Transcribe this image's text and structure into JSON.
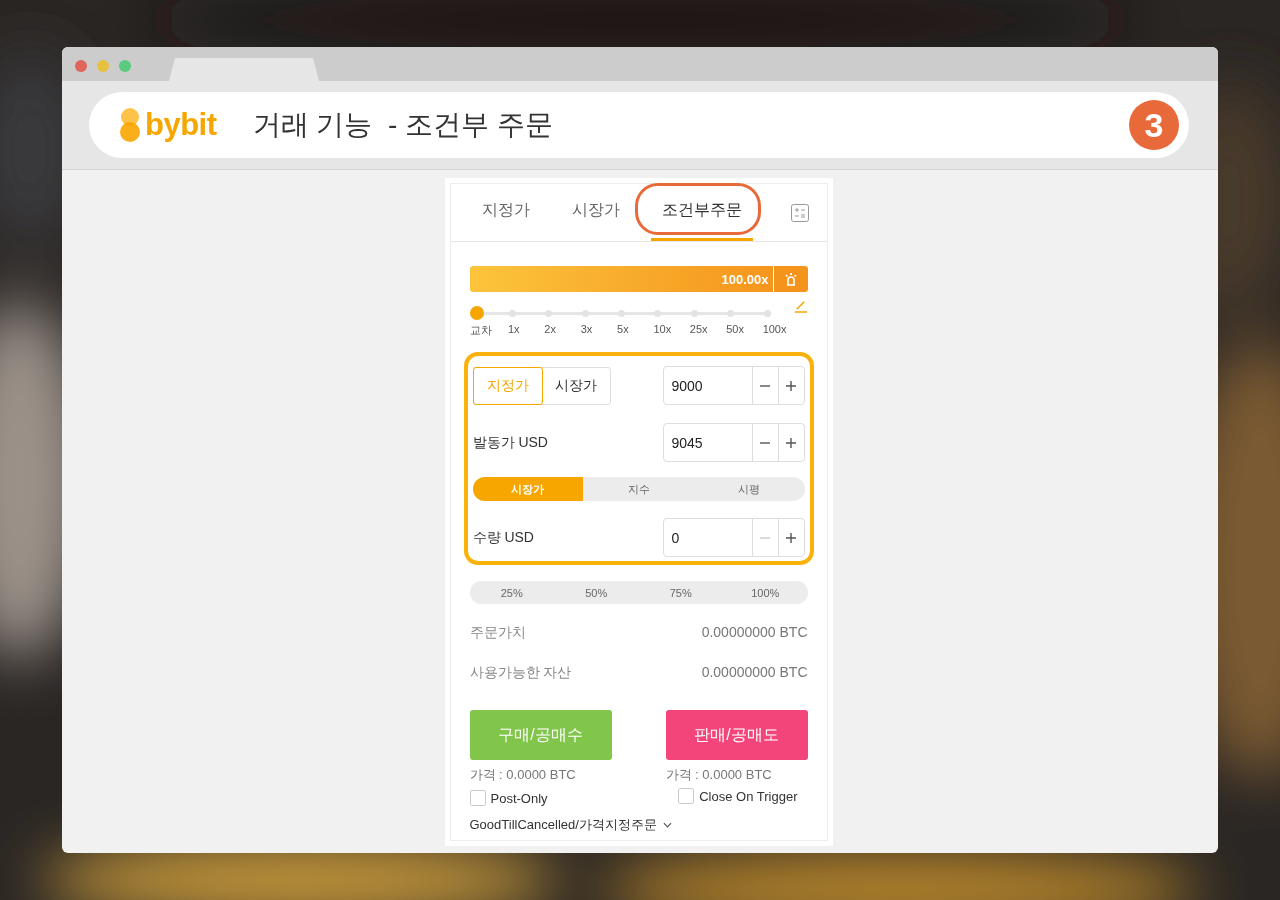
{
  "header": {
    "logo": "bybit",
    "title": "거래 기능  - 조건부 주문",
    "step": "3"
  },
  "order_tabs": [
    {
      "label": "지정가",
      "selected": false,
      "circled": false
    },
    {
      "label": "시장가",
      "selected": false,
      "circled": false
    },
    {
      "label": "조건부주문",
      "selected": true,
      "circled": true
    }
  ],
  "leverage": {
    "reading": "100.00x",
    "level": 1.0,
    "marks": [
      {
        "label": "교차",
        "selected": true
      },
      {
        "label": "1x",
        "selected": false
      },
      {
        "label": "2x",
        "selected": false
      },
      {
        "label": "3x",
        "selected": false
      },
      {
        "label": "5x",
        "selected": false
      },
      {
        "label": "10x",
        "selected": false
      },
      {
        "label": "25x",
        "selected": false
      },
      {
        "label": "50x",
        "selected": false
      },
      {
        "label": "100x",
        "selected": false
      }
    ]
  },
  "form": {
    "highlighted": true,
    "price_types": [
      {
        "label": "지정가",
        "selected": true
      },
      {
        "label": "시장가",
        "selected": false
      }
    ],
    "price": {
      "value": "9000",
      "minus_disabled": false
    },
    "trigger": {
      "label": "발동가 USD",
      "value": "9045",
      "minus_disabled": false
    },
    "trigger_sources": [
      {
        "label": "시장가",
        "selected": true
      },
      {
        "label": "지수",
        "selected": false
      },
      {
        "label": "시평",
        "selected": false
      }
    ],
    "quantity": {
      "label": "수량 USD",
      "value": "0",
      "minus_disabled": true
    }
  },
  "percentages": [
    "25%",
    "50%",
    "75%",
    "100%"
  ],
  "stats": [
    {
      "label": "주문가치",
      "value": "0.00000000 BTC"
    },
    {
      "label": "사용가능한 자산",
      "value": "0.00000000 BTC"
    }
  ],
  "actions": [
    {
      "kind": "buy",
      "label": "구매/공매수",
      "price": "가격 : 0.0000 BTC"
    },
    {
      "kind": "sell",
      "label": "판매/공매도",
      "price": "가격 : 0.0000 BTC"
    }
  ],
  "options": [
    {
      "label": "Post-Only",
      "checked": false
    },
    {
      "label": "Close On Trigger",
      "checked": false
    }
  ],
  "time_in_force": "GoodTillCancelled/가격지정주문"
}
